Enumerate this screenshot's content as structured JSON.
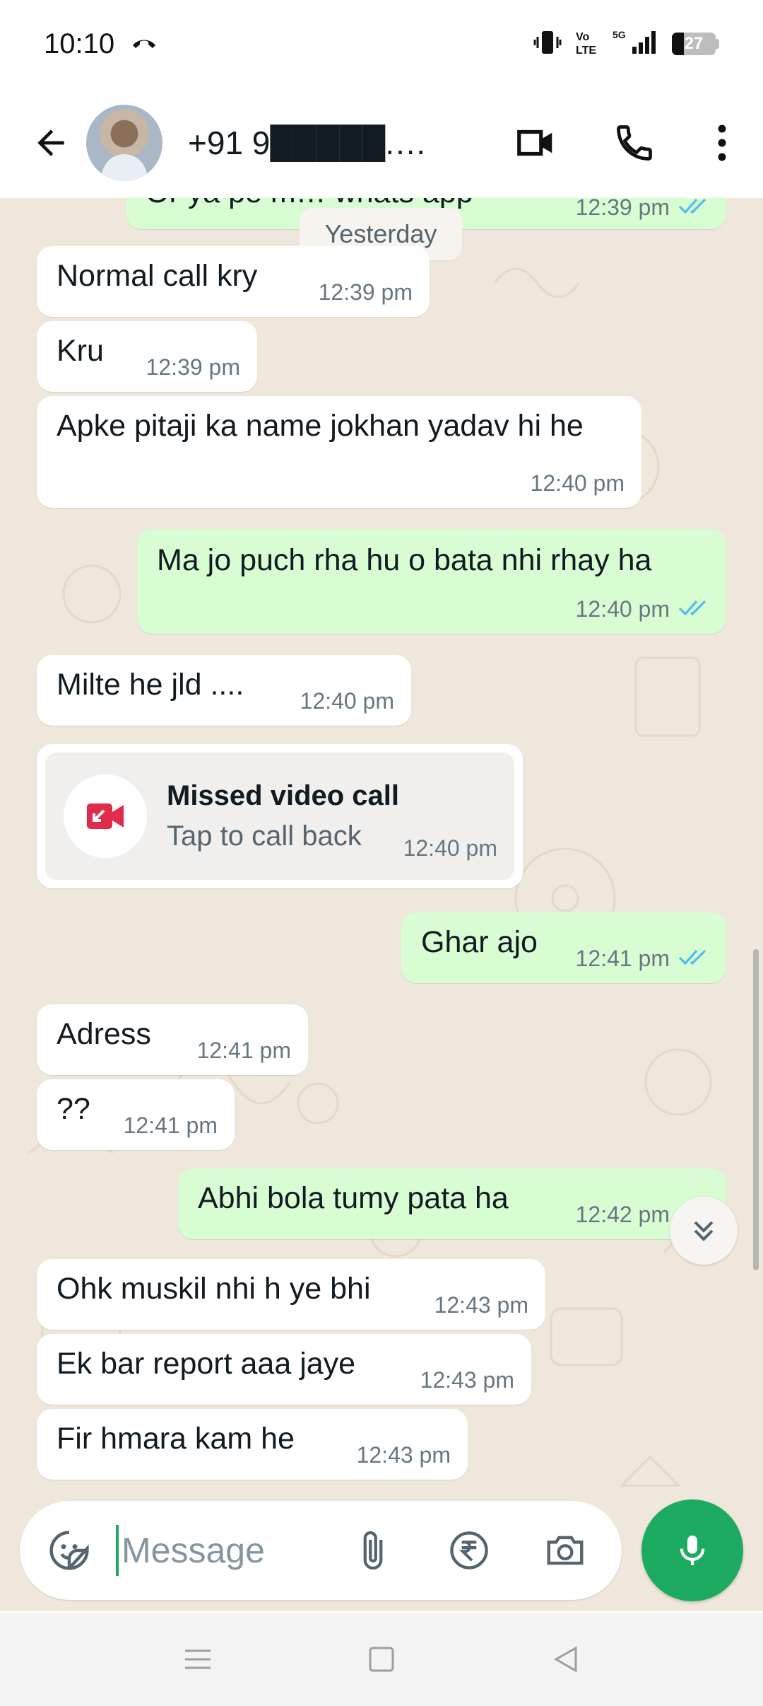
{
  "status_bar": {
    "time": "10:10",
    "battery": "27"
  },
  "header": {
    "contact_name": "+91 9█████.14…",
    "back_icon": "arrow-left-icon",
    "video_icon": "videocam-icon",
    "call_icon": "phone-icon",
    "menu_icon": "more-vert-icon"
  },
  "chat": {
    "partial_top": {
      "text": "Or ya pe m… whats app",
      "time": "12:39 pm"
    },
    "date_chip": "Yesterday",
    "messages": [
      {
        "text": "Normal call kry",
        "time": "12:39 pm"
      },
      {
        "text": "Kru",
        "time": "12:39 pm"
      },
      {
        "text": "Apke pitaji ka name jokhan yadav hi he",
        "time": "12:40 pm"
      },
      {
        "text": "Ma jo puch rha hu o bata nhi rhay ha",
        "time": "12:40 pm"
      },
      {
        "text": "Milte he jld ....",
        "time": "12:40 pm"
      },
      {
        "text": "Ghar ajo",
        "time": "12:41 pm"
      },
      {
        "text": "Adress",
        "time": "12:41 pm"
      },
      {
        "text": "??",
        "time": "12:41 pm"
      },
      {
        "text": "Abhi bola tumy pata ha",
        "time": "12:42 pm"
      },
      {
        "text": "Ohk muskil nhi h ye bhi",
        "time": "12:43 pm"
      },
      {
        "text": "Ek bar report aaa jaye",
        "time": "12:43 pm"
      },
      {
        "text": "Fir hmara kam he",
        "time": "12:43 pm"
      }
    ],
    "missed_call": {
      "title": "Missed video call",
      "subtitle": "Tap to call back",
      "time": "12:40 pm"
    }
  },
  "composer": {
    "placeholder": "Message"
  },
  "colors": {
    "accent": "#1daa61",
    "outgoing_bubble": "#d9fdd3",
    "incoming_bubble": "#ffffff",
    "read_ticks": "#53bdeb",
    "missed_call": "#e02b4b",
    "chat_background": "#efe7dc"
  }
}
